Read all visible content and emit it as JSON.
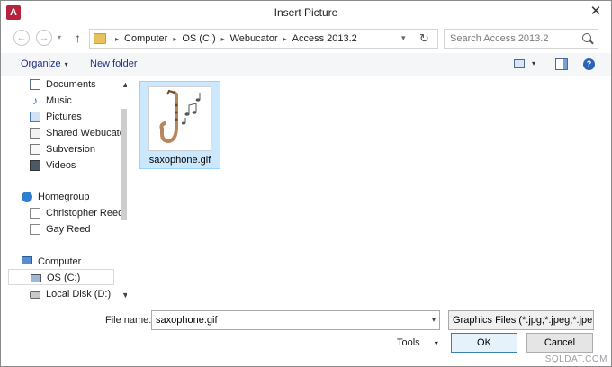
{
  "window": {
    "title": "Insert Picture",
    "app_icon_text": "A",
    "close_glyph": "✕"
  },
  "nav": {
    "back_glyph": "←",
    "forward_glyph": "→",
    "dropdown_glyph": "▾",
    "up_glyph": "↑"
  },
  "address": {
    "crumbs": [
      "Computer",
      "OS (C:)",
      "Webucator",
      "Access 2013.2"
    ],
    "separator": "▸",
    "dropdown_glyph": "▾",
    "refresh_glyph": "↻"
  },
  "search": {
    "placeholder": "Search Access 2013.2"
  },
  "toolbar": {
    "organize_label": "Organize",
    "organize_caret": "▾",
    "new_folder_label": "New folder",
    "views_caret": "▾",
    "help_label": "?"
  },
  "navpane": {
    "items": [
      {
        "label": "Documents",
        "icon": "documents-icon"
      },
      {
        "label": "Music",
        "icon": "music-icon"
      },
      {
        "label": "Pictures",
        "icon": "pictures-icon"
      },
      {
        "label": "Shared Webucator",
        "icon": "shared-folder-icon"
      },
      {
        "label": "Subversion",
        "icon": "subversion-icon"
      },
      {
        "label": "Videos",
        "icon": "videos-icon"
      }
    ],
    "homegroup": {
      "label": "Homegroup",
      "members": [
        "Christopher Reed",
        "Gay Reed"
      ]
    },
    "computer": {
      "label": "Computer",
      "drives": [
        "OS (C:)",
        "Local Disk (D:)"
      ],
      "selected": "OS (C:)"
    },
    "scroll_up_glyph": "▲",
    "scroll_down_glyph": "▼"
  },
  "files": [
    {
      "name": "saxophone.gif",
      "selected": true
    }
  ],
  "footer": {
    "file_name_label": "File name:",
    "file_name_value": "saxophone.gif",
    "file_name_dropdown": "▾",
    "file_type_value": "Graphics Files (*.jpg;*.jpeg;*.jpe",
    "tools_label": "Tools",
    "tools_caret": "▾",
    "ok_label": "OK",
    "cancel_label": "Cancel"
  },
  "watermark": "SQLDAT.COM",
  "colors": {
    "selection": "#cce8ff",
    "selection_border": "#99d1ff",
    "link": "#1e3287",
    "app_icon": "#b7233b"
  }
}
